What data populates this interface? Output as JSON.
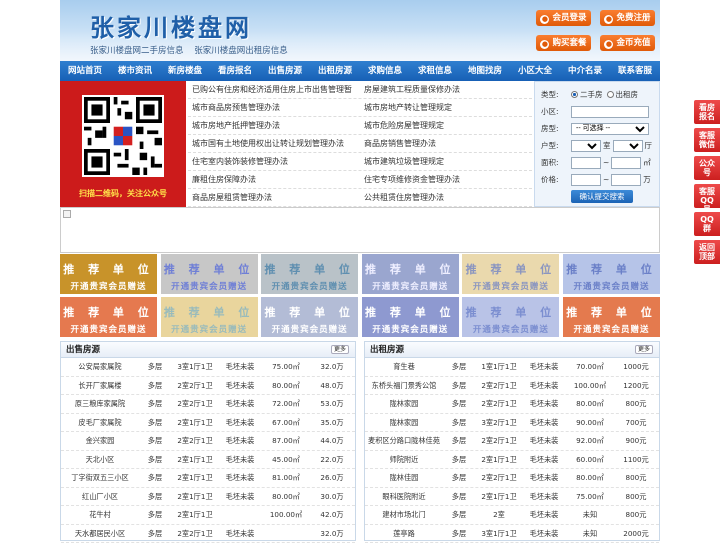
{
  "header": {
    "title": "张家川楼盘网",
    "subtitles": [
      "张家川楼盘网二手房信息",
      "张家川楼盘网出租房信息"
    ],
    "buttons": [
      "会员登录",
      "免费注册",
      "购买套餐",
      "金币充值"
    ]
  },
  "nav": [
    "网站首页",
    "楼市资讯",
    "新房楼盘",
    "看房报名",
    "出售房源",
    "出租房源",
    "求购信息",
    "求租信息",
    "地图找房",
    "小区大全",
    "中介名录",
    "联系客服"
  ],
  "qr_caption": "扫描二维码，关注公众号",
  "links": [
    [
      "已购公有住房和经济适用住房上市出售管理暂",
      "房屋建筑工程质量保修办法"
    ],
    [
      "城市商品房预售管理办法",
      "城市房地产转让管理规定"
    ],
    [
      "城市房地产抵押管理办法",
      "城市危险房屋管理规定"
    ],
    [
      "城市国有土地使用权出让转让规划管理办法",
      "商品房销售管理办法"
    ],
    [
      "住宅室内装饰装修管理办法",
      "城市建筑垃圾管理规定"
    ],
    [
      "廉租住房保障办法",
      "住宅专项维修资金管理办法"
    ],
    [
      "商品房屋租赁管理办法",
      "公共租赁住房管理办法"
    ]
  ],
  "search": {
    "type_label": "类型:",
    "type_options": [
      "二手房",
      "出租房"
    ],
    "community_label": "小区:",
    "layout_label": "房型:",
    "layout_select": "-- 可选择 --",
    "unit_label": "户型:",
    "unit_room": "室",
    "unit_hall": "厅",
    "area_label": "面积:",
    "area_unit": "㎡",
    "price_label": "价格:",
    "price_unit": "万",
    "dash": "~",
    "submit": "确认提交搜索"
  },
  "ads": {
    "line1": "推 荐 单 位",
    "line2": "开通贵宾会员赠送",
    "colors": [
      "#c8932a",
      "#c7c7c7",
      "#b9c2c8",
      "#9aa6cf",
      "#ead9ad",
      "#b6c4e8",
      "#e5794f",
      "#e9d59d",
      "#b3bcd6",
      "#8e99d0",
      "#b9c3e7",
      "#e47a4e"
    ],
    "text_colors": [
      "#fff",
      "#6f7fd6",
      "#5f8fb0",
      "#eef",
      "#8a95c0",
      "#6b80c8",
      "#fff",
      "#9bb",
      "#fff",
      "#fff",
      "#7b8ed0",
      "#fff"
    ]
  },
  "sale": {
    "title": "出售房源",
    "more": "更多",
    "rows": [
      [
        "公安局家属院",
        "多层",
        "3室1厅1卫",
        "毛坯未装",
        "75.00㎡",
        "32.0万"
      ],
      [
        "长开厂家属楼",
        "多层",
        "2室2厅1卫",
        "毛坯未装",
        "80.00㎡",
        "48.0万"
      ],
      [
        "原三粮库家属院",
        "多层",
        "2室2厅1卫",
        "毛坯未装",
        "72.00㎡",
        "53.0万"
      ],
      [
        "皮毛厂家属院",
        "多层",
        "2室1厅1卫",
        "毛坯未装",
        "67.00㎡",
        "35.0万"
      ],
      [
        "金兴家园",
        "多层",
        "2室2厅1卫",
        "毛坯未装",
        "87.00㎡",
        "44.0万"
      ],
      [
        "天北小区",
        "多层",
        "2室1厅1卫",
        "毛坯未装",
        "45.00㎡",
        "22.0万"
      ],
      [
        "丁字街双五三小区",
        "多层",
        "2室1厅1卫",
        "毛坯未装",
        "81.00㎡",
        "26.0万"
      ],
      [
        "红山厂小区",
        "多层",
        "2室1厅1卫",
        "毛坯未装",
        "80.00㎡",
        "30.0万"
      ],
      [
        "花牛村",
        "多层",
        "2室1厅1卫",
        "",
        "100.00㎡",
        "42.0万"
      ],
      [
        "天水都居民小区",
        "多层",
        "2室2厅1卫",
        "毛坯未装",
        "",
        "32.0万"
      ]
    ]
  },
  "rent": {
    "title": "出租房源",
    "more": "更多",
    "rows": [
      [
        "育生巷",
        "多层",
        "1室1厅1卫",
        "毛坯未装",
        "70.00㎡",
        "1000元"
      ],
      [
        "东桥头福门景秀公馆",
        "多层",
        "2室2厅1卫",
        "毛坯未装",
        "100.00㎡",
        "1200元"
      ],
      [
        "陇林家园",
        "多层",
        "2室2厅1卫",
        "毛坯未装",
        "80.00㎡",
        "800元"
      ],
      [
        "陇林家园",
        "多层",
        "3室2厅1卫",
        "毛坯未装",
        "90.00㎡",
        "700元"
      ],
      [
        "麦积区分路口陇林佳苑",
        "多层",
        "2室2厅1卫",
        "毛坯未装",
        "92.00㎡",
        "900元"
      ],
      [
        "师院附近",
        "多层",
        "2室1厅1卫",
        "毛坯未装",
        "60.00㎡",
        "1100元"
      ],
      [
        "陇林佳园",
        "多层",
        "2室2厅1卫",
        "毛坯未装",
        "80.00㎡",
        "800元"
      ],
      [
        "眼科医院附近",
        "多层",
        "2室1厅1卫",
        "毛坯未装",
        "75.00㎡",
        "800元"
      ],
      [
        "建材市场北门",
        "多层",
        "2室",
        "毛坯未装",
        "未知",
        "800元"
      ],
      [
        "莲亭路",
        "多层",
        "3室1厅1卫",
        "毛坯未装",
        "未知",
        "2000元"
      ]
    ]
  },
  "side": [
    "看房报名",
    "客服微信",
    "公众号",
    "客服QQ号",
    "QQ群",
    "返回顶部"
  ]
}
